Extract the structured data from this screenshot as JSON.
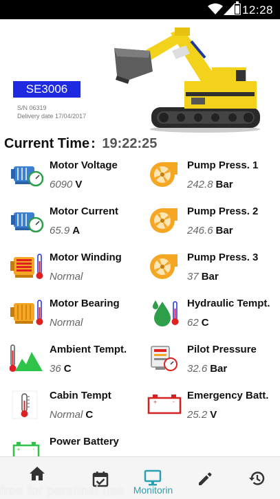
{
  "status_bar": {
    "time": "12:28"
  },
  "header": {
    "model": "SE3006",
    "serial": "S/N 06319",
    "delivery_label": "Delivery date",
    "delivery_date": "17/04/2017"
  },
  "current_time": {
    "label": "Current Time",
    "separator": ":",
    "value": "19:22:25"
  },
  "metrics": [
    {
      "label": "Motor Voltage",
      "value": "6090",
      "unit": "V",
      "icon": "motor-gauge-icon"
    },
    {
      "label": "Pump Press. 1",
      "value": "242.8",
      "unit": "Bar",
      "icon": "pump-icon"
    },
    {
      "label": "Motor Current",
      "value": "65.9",
      "unit": "A",
      "icon": "motor-gauge-icon"
    },
    {
      "label": "Pump Press. 2",
      "value": "246.6",
      "unit": "Bar",
      "icon": "pump-icon"
    },
    {
      "label": "Motor Winding",
      "value": "Normal",
      "unit": "",
      "icon": "motor-thermometer-icon"
    },
    {
      "label": "Pump Press. 3",
      "value": "37",
      "unit": "Bar",
      "icon": "pump-icon"
    },
    {
      "label": "Motor Bearing",
      "value": "Normal",
      "unit": "",
      "icon": "motor-thermometer-icon"
    },
    {
      "label": "Hydraulic Tempt.",
      "value": "62",
      "unit": "C",
      "icon": "hydraulic-drop-icon"
    },
    {
      "label": "Ambient Tempt.",
      "value": "36",
      "unit": "C",
      "icon": "ambient-temperature-icon"
    },
    {
      "label": "Pilot Pressure",
      "value": "32.6",
      "unit": "Bar",
      "icon": "pilot-pressure-icon"
    },
    {
      "label": "Cabin Tempt",
      "value": "Normal",
      "unit": "C",
      "icon": "cabin-thermometer-icon"
    },
    {
      "label": "Emergency Batt.",
      "value": "25.2",
      "unit": "V",
      "icon": "battery-red-icon"
    },
    {
      "label": "Power Battery",
      "value": "",
      "unit": "",
      "icon": "battery-green-icon"
    }
  ],
  "bottom_nav": [
    {
      "name": "home",
      "label": "",
      "icon": "home-icon"
    },
    {
      "name": "calendar",
      "label": "",
      "icon": "calendar-check-icon"
    },
    {
      "name": "monitoring",
      "label": "Monitorin",
      "icon": "monitor-icon",
      "active": true
    },
    {
      "name": "edit",
      "label": "",
      "icon": "pencil-icon"
    },
    {
      "name": "history",
      "label": "",
      "icon": "history-icon"
    }
  ],
  "watermark": "free for personal use",
  "colors": {
    "accent": "#2c9fb0",
    "model_badge": "#1d2ae0",
    "machine_yellow": "#f2d21b",
    "motor_blue": "#3a7fd1",
    "pump_orange": "#f5a623"
  }
}
